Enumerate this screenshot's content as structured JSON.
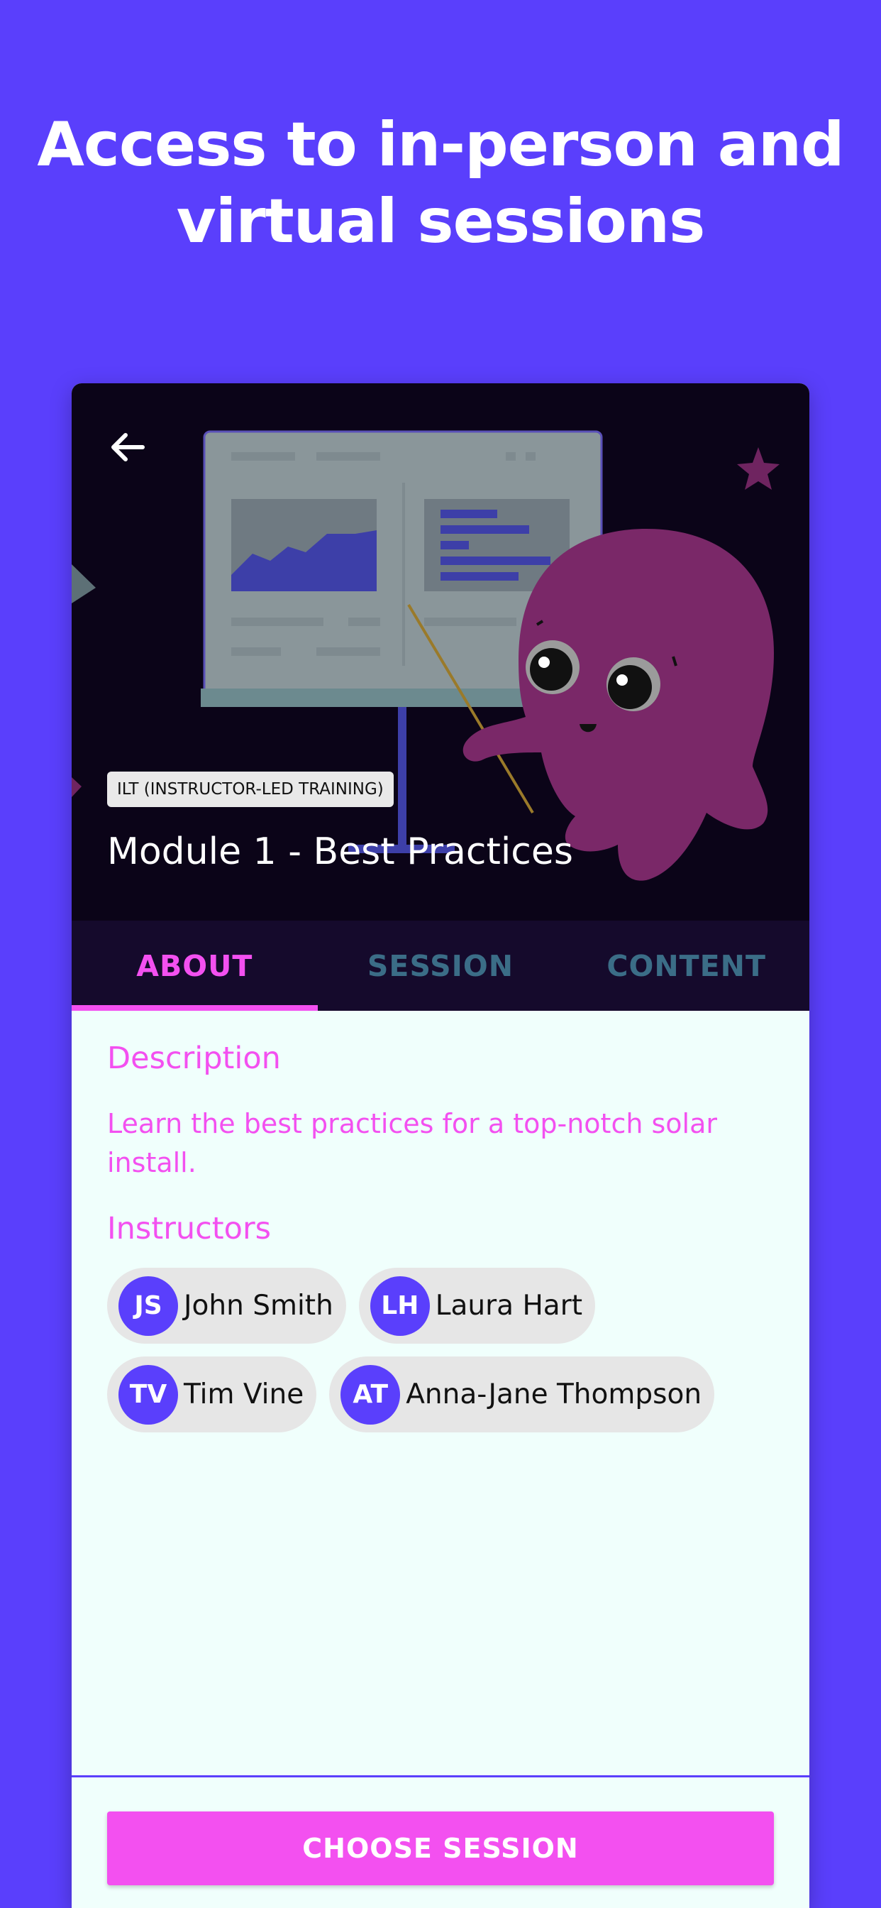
{
  "promo": {
    "headline_line1": "Access to in-person and",
    "headline_line2": "virtual sessions"
  },
  "course": {
    "type_badge": "ILT (INSTRUCTOR-LED TRAINING)",
    "title": "Module 1 - Best Practices"
  },
  "tabs": [
    {
      "label": "ABOUT",
      "active": true
    },
    {
      "label": "SESSION",
      "active": false
    },
    {
      "label": "CONTENT",
      "active": false
    }
  ],
  "about": {
    "description_heading": "Description",
    "description_text": "Learn the best practices for a top-notch solar install.",
    "instructors_heading": "Instructors",
    "instructors": [
      {
        "initials": "JS",
        "name": "John Smith"
      },
      {
        "initials": "LH",
        "name": "Laura Hart"
      },
      {
        "initials": "TV",
        "name": "Tim Vine"
      },
      {
        "initials": "AT",
        "name": "Anna-Jane Thompson"
      }
    ]
  },
  "actions": {
    "choose_session": "CHOOSE SESSION"
  },
  "icons": {
    "back": "arrow-left-icon",
    "mascot": "octopus-illustration",
    "presentation": "presentation-board-illustration"
  },
  "colors": {
    "background": "#5a3ffc",
    "accent": "#f350f0",
    "tab_inactive": "#3b6d87",
    "hero_bg": "#0b0418",
    "tab_bar_bg": "#150a2c",
    "avatar": "#5a3ffc"
  }
}
